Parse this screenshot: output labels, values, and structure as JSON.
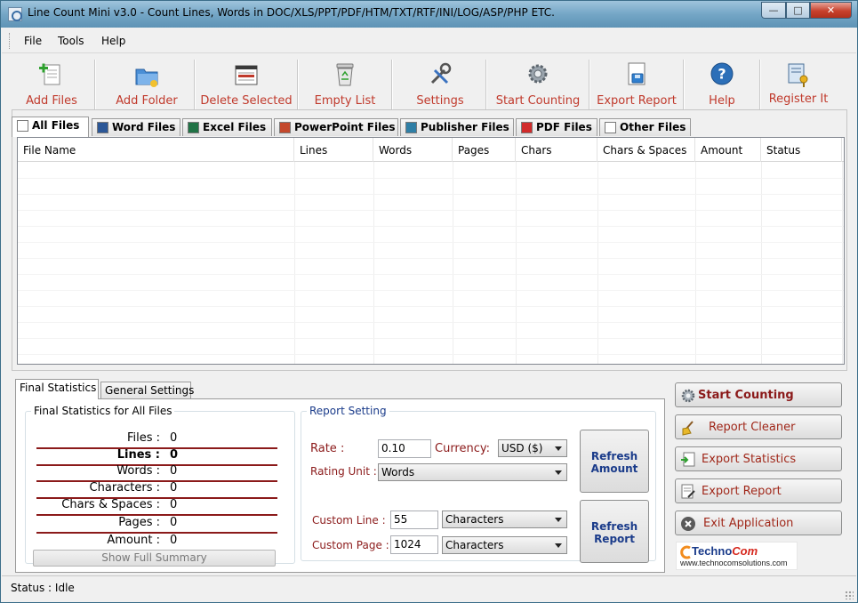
{
  "window": {
    "title": "Line Count Mini v3.0 - Count Lines, Words in DOC/XLS/PPT/PDF/HTM/TXT/RTF/INI/LOG/ASP/PHP ETC."
  },
  "menu": {
    "file": "File",
    "tools": "Tools",
    "help": "Help"
  },
  "toolbar": {
    "add_files": "Add Files",
    "add_folder": "Add Folder",
    "delete_selected": "Delete Selected",
    "empty_list": "Empty List",
    "settings": "Settings",
    "start_counting": "Start Counting",
    "export_report": "Export Report",
    "help": "Help",
    "register_it": "Register It"
  },
  "tabs": [
    "All Files",
    "Word Files",
    "Excel Files",
    "PowerPoint Files",
    "Publisher Files",
    "PDF Files",
    "Other Files"
  ],
  "grid": {
    "columns": [
      "File Name",
      "Lines",
      "Words",
      "Pages",
      "Chars",
      "Chars & Spaces",
      "Amount",
      "Status"
    ],
    "rows": []
  },
  "bottom_tabs": [
    "Final Statistics",
    "General Settings"
  ],
  "final_stats": {
    "group_title": "Final Statistics for All Files",
    "files": {
      "label": "Files :",
      "value": "0"
    },
    "lines": {
      "label": "Lines :",
      "value": "0"
    },
    "words": {
      "label": "Words :",
      "value": "0"
    },
    "characters": {
      "label": "Characters :",
      "value": "0"
    },
    "chars_spaces": {
      "label": "Chars & Spaces :",
      "value": "0"
    },
    "pages": {
      "label": "Pages :",
      "value": "0"
    },
    "amount": {
      "label": "Amount :",
      "value": "0"
    },
    "summary_button": "Show Full Summary"
  },
  "report_setting": {
    "group_title": "Report Setting",
    "rate_label": "Rate :",
    "rate_value": "0.10",
    "currency_label": "Currency:",
    "currency_value": "USD ($)",
    "rating_unit_label": "Rating Unit :",
    "rating_unit_value": "Words",
    "custom_line_label": "Custom Line :",
    "custom_line_value": "55",
    "custom_line_unit": "Characters",
    "custom_page_label": "Custom Page :",
    "custom_page_value": "1024",
    "custom_page_unit": "Characters",
    "refresh_amount": [
      "Refresh",
      "Amount"
    ],
    "refresh_report": [
      "Refresh",
      "Report"
    ]
  },
  "actions": {
    "start_counting": "Start Counting",
    "report_cleaner": "Report Cleaner",
    "export_statistics": "Export Statistics",
    "export_report": "Export Report",
    "exit_application": "Exit Application"
  },
  "logo": {
    "name_part1": "Techno",
    "name_part2": "Com",
    "url": "www.technocomsolutions.com"
  },
  "status": {
    "text": "Status : Idle"
  },
  "colors": {
    "accent_red": "#c0392b",
    "dark_red": "#8b1a1a",
    "link_blue": "#1a3b8a"
  }
}
